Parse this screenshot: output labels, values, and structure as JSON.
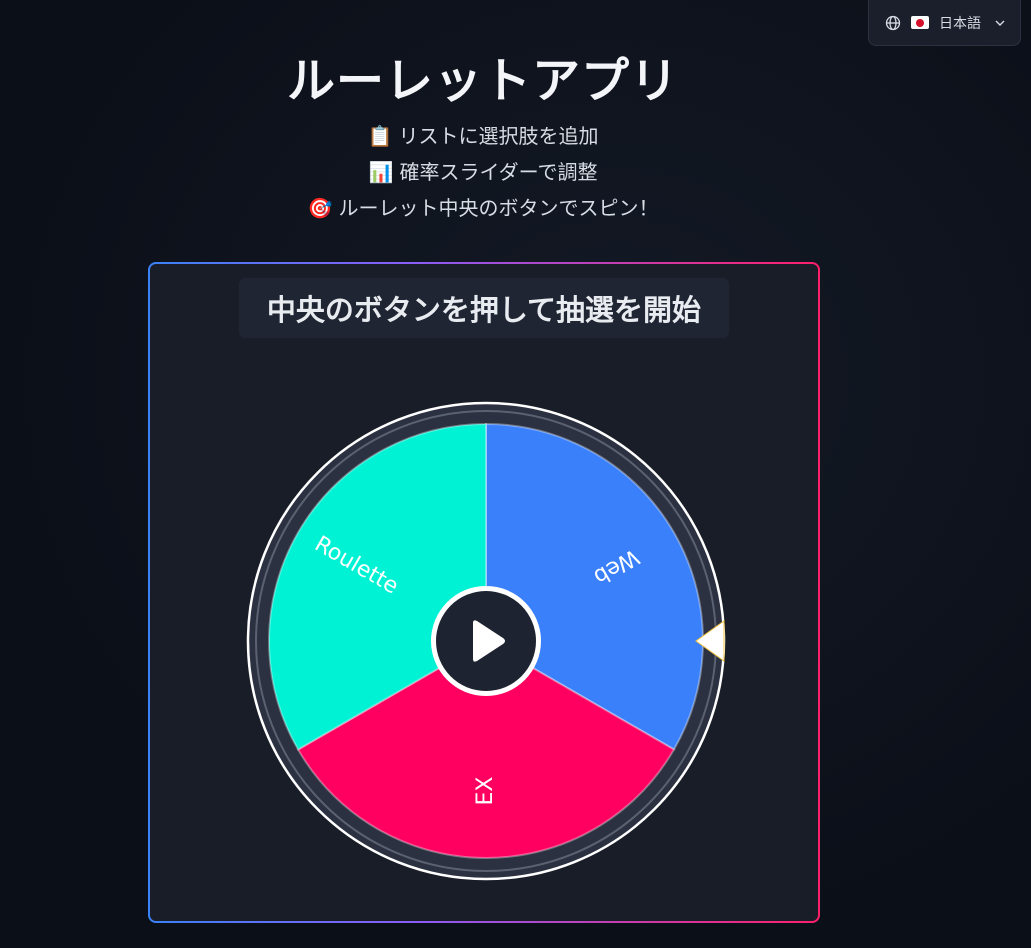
{
  "language": {
    "flag": "🇯🇵",
    "label": "日本語"
  },
  "header": {
    "title": "ルーレットアプリ",
    "steps": [
      {
        "icon": "📋",
        "text": "リストに選択肢を追加"
      },
      {
        "icon": "📊",
        "text": "確率スライダーで調整"
      },
      {
        "icon": "🎯",
        "text": "ルーレット中央のボタンでスピン！"
      }
    ]
  },
  "panel": {
    "prompt": "中央のボタンを押して抽選を開始"
  },
  "wheel": {
    "segments": [
      {
        "label": "Web",
        "color": "#3a80fb"
      },
      {
        "label": "EX",
        "color": "#ff0060"
      },
      {
        "label": "Roulette",
        "color": "#00f2d4"
      }
    ]
  }
}
